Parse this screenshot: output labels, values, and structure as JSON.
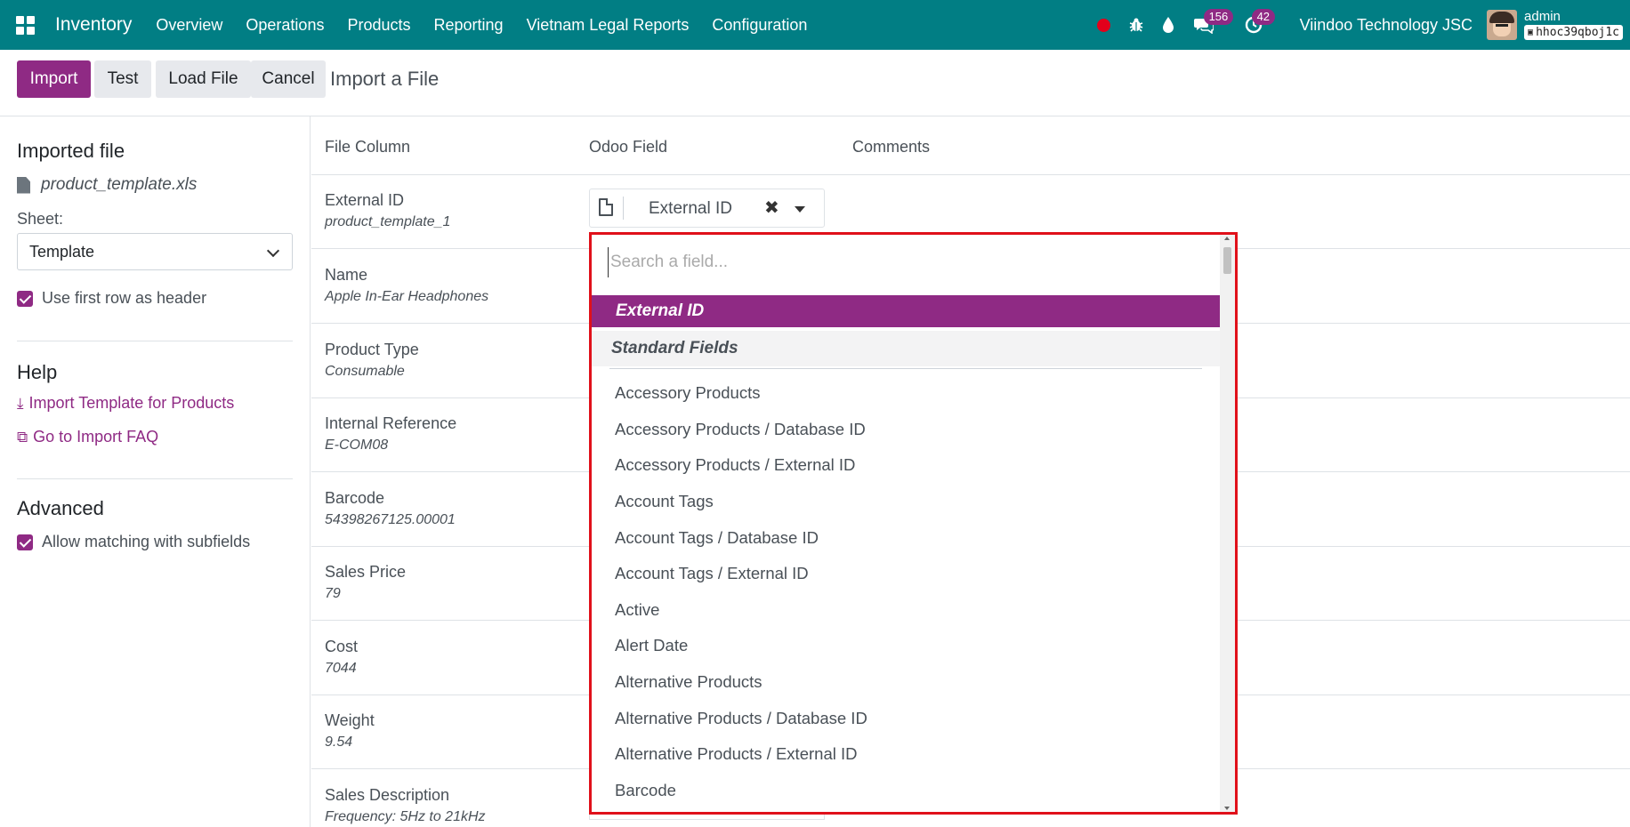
{
  "navbar": {
    "app_name": "Inventory",
    "menu": [
      "Overview",
      "Operations",
      "Products",
      "Reporting",
      "Vietnam Legal Reports",
      "Configuration"
    ],
    "messages_count": "156",
    "activities_count": "42",
    "company": "Viindoo Technology JSC",
    "user_name": "admin",
    "database": "hhoc39qboj1c",
    "accent_color": "#017e84"
  },
  "toolbar": {
    "import_label": "Import",
    "test_label": "Test",
    "load_file_label": "Load File",
    "cancel_label": "Cancel",
    "title": "Import a File",
    "primary_color": "#8f2a84"
  },
  "sidebar": {
    "imported_file_heading": "Imported file",
    "file_name": "product_template.xls",
    "sheet_label": "Sheet:",
    "sheet_value": "Template",
    "use_first_row_label": "Use first row as header",
    "help_heading": "Help",
    "template_link": "Import Template for Products",
    "faq_link": "Go to Import FAQ",
    "advanced_heading": "Advanced",
    "subfields_label": "Allow matching with subfields"
  },
  "table": {
    "headers": [
      "File Column",
      "Odoo Field",
      "Comments"
    ],
    "rows": [
      {
        "name": "External ID",
        "value": "product_template_1"
      },
      {
        "name": "Name",
        "value": "Apple In-Ear Headphones"
      },
      {
        "name": "Product Type",
        "value": "Consumable"
      },
      {
        "name": "Internal Reference",
        "value": "E-COM08"
      },
      {
        "name": "Barcode",
        "value": "54398267125.00001"
      },
      {
        "name": "Sales Price",
        "value": "79"
      },
      {
        "name": "Cost",
        "value": "7044"
      },
      {
        "name": "Weight",
        "value": "9.54"
      },
      {
        "name": "Sales Description",
        "value": "Frequency: 5Hz to 21kHz"
      }
    ],
    "selected_field": "External ID"
  },
  "dropdown": {
    "search_placeholder": "Search a field...",
    "selected": "External ID",
    "group": "Standard Fields",
    "items": [
      "Accessory Products",
      "Accessory Products / Database ID",
      "Accessory Products / External ID",
      "Account Tags",
      "Account Tags / Database ID",
      "Account Tags / External ID",
      "Active",
      "Alert Date",
      "Alternative Products",
      "Alternative Products / Database ID",
      "Alternative Products / External ID",
      "Barcode"
    ]
  }
}
